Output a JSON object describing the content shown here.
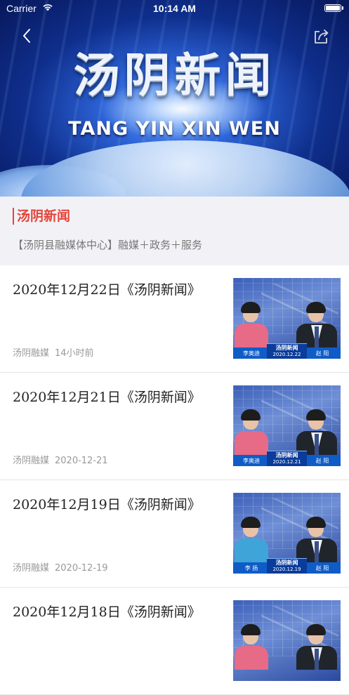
{
  "status_bar": {
    "carrier": "Carrier",
    "time": "10:14 AM"
  },
  "hero": {
    "title": "汤阴新闻",
    "subtitle": "TANG YIN XIN WEN"
  },
  "channel": {
    "name": "汤阴新闻",
    "description": "【汤阴县融媒体中心】融媒＋政务＋服务"
  },
  "items": [
    {
      "title": "2020年12月22日《汤阴新闻》",
      "source": "汤阴融媒",
      "time": "14小时前",
      "thumb": {
        "caption": "汤阴新闻",
        "date": "2020.12.22",
        "anchor_left": "李奥迪",
        "anchor_right": "赵 阳",
        "female_color": "#e76a86"
      }
    },
    {
      "title": "2020年12月21日《汤阴新闻》",
      "source": "汤阴融媒",
      "time": "2020-12-21",
      "thumb": {
        "caption": "汤阴新闻",
        "date": "2020.12.21",
        "anchor_left": "李奥迪",
        "anchor_right": "赵 阳",
        "female_color": "#e76a86"
      }
    },
    {
      "title": "2020年12月19日《汤阴新闻》",
      "source": "汤阴融媒",
      "time": "2020-12-19",
      "thumb": {
        "caption": "汤阴新闻",
        "date": "2020.12.19",
        "anchor_left": "李 扬",
        "anchor_right": "赵 阳",
        "female_color": "#3fa4d8"
      }
    },
    {
      "title": "2020年12月18日《汤阴新闻》",
      "source": "",
      "time": "",
      "thumb": {
        "caption": "",
        "date": "",
        "anchor_left": "",
        "anchor_right": "",
        "female_color": "#e76a86"
      }
    }
  ]
}
